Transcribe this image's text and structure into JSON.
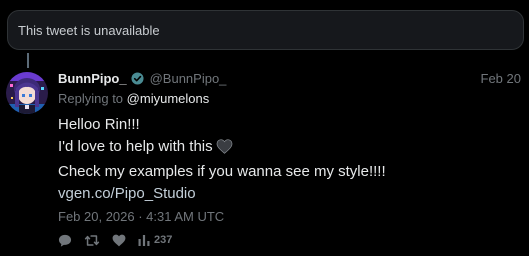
{
  "quoted_notice": {
    "text": "This tweet is unavailable"
  },
  "tweet": {
    "author": {
      "display_name": "BunnPipo_",
      "handle": "@BunnPipo_",
      "verified": true
    },
    "date_short": "Feb 20",
    "replying_prefix": "Replying to",
    "replying_to": "@miyumelons",
    "body_lines": [
      "Helloo Rin!!!",
      "I'd love to help with this",
      "Check my examples if you wanna see my style!!!!"
    ],
    "emoji": "black-heart",
    "link": "vgen.co/Pipo_Studio",
    "timestamp": "Feb 20, 2026 · 4:31 AM UTC",
    "stats": {
      "views": "237"
    }
  },
  "icons": {
    "verified": "verified-badge-icon",
    "reply": "reply-icon",
    "retweet": "retweet-icon",
    "like": "heart-icon",
    "views": "bar-chart-icon"
  },
  "colors": {
    "background": "#000000",
    "text": "#e7e9ea",
    "muted": "#71767b",
    "verified": "#4a8b93",
    "card": "#16181c"
  }
}
